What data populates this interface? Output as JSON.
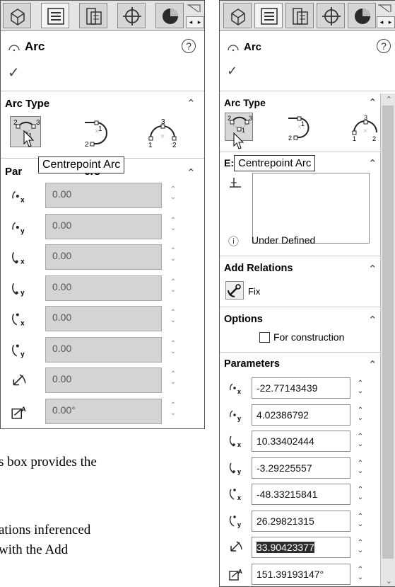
{
  "left_panel": {
    "title": "Arc",
    "help_glyph": "?",
    "ok_glyph": "✓",
    "arc_type_header": "Arc Type",
    "arc_buttons": [
      {
        "name": "centrepoint-arc-icon",
        "digits": [
          "2",
          "1",
          "3"
        ],
        "active": true
      },
      {
        "name": "tangent-arc-icon",
        "digits": [
          "1",
          "2"
        ],
        "active": false
      },
      {
        "name": "three-point-arc-icon",
        "digits": [
          "3",
          "1",
          "2"
        ],
        "active": false
      }
    ],
    "tooltip": "Centrepoint Arc",
    "parameters_header_visible": "Par",
    "parameters_header_tail": "ers",
    "parameters": [
      {
        "icon": "center-x-icon",
        "value": "0.00"
      },
      {
        "icon": "center-y-icon",
        "value": "0.00"
      },
      {
        "icon": "start-x-icon",
        "value": "0.00"
      },
      {
        "icon": "start-y-icon",
        "value": "0.00"
      },
      {
        "icon": "end-x-icon",
        "value": "0.00"
      },
      {
        "icon": "end-y-icon",
        "value": "0.00"
      },
      {
        "icon": "radius-icon",
        "value": "0.00"
      },
      {
        "icon": "angle-icon",
        "value": "0.00°"
      }
    ]
  },
  "right_panel": {
    "title": "Arc",
    "help_glyph": "?",
    "ok_glyph": "✓",
    "arc_type_header": "Arc Type",
    "tooltip": "Centrepoint Arc",
    "existing_header_visible": "E:",
    "status_glyph": "ⓘ",
    "status": "Under Defined",
    "add_relations_header": "Add Relations",
    "fix_label": "Fix",
    "options_header": "Options",
    "for_construction_label": "For construction",
    "parameters_header": "Parameters",
    "parameters": [
      {
        "icon": "center-x-icon",
        "value": "-22.77143439",
        "selected": false
      },
      {
        "icon": "center-y-icon",
        "value": "4.02386792",
        "selected": false
      },
      {
        "icon": "start-x-icon",
        "value": "10.33402444",
        "selected": false
      },
      {
        "icon": "start-y-icon",
        "value": "-3.29225557",
        "selected": false
      },
      {
        "icon": "end-x-icon",
        "value": "-48.33215841",
        "selected": false
      },
      {
        "icon": "end-y-icon",
        "value": "26.29821315",
        "selected": false
      },
      {
        "icon": "radius-icon",
        "value": "33.90423377",
        "selected": true
      },
      {
        "icon": "angle-icon",
        "value": "151.39193147°",
        "selected": false
      }
    ]
  },
  "body_text": {
    "line1": "s box provides the",
    "line2": "ations inferenced",
    "line3": "with the Add"
  },
  "colors": {
    "field_disabled": "#d4d4d4",
    "selection": "#2b2b2b",
    "tab_bar": "#e4e4e4"
  }
}
